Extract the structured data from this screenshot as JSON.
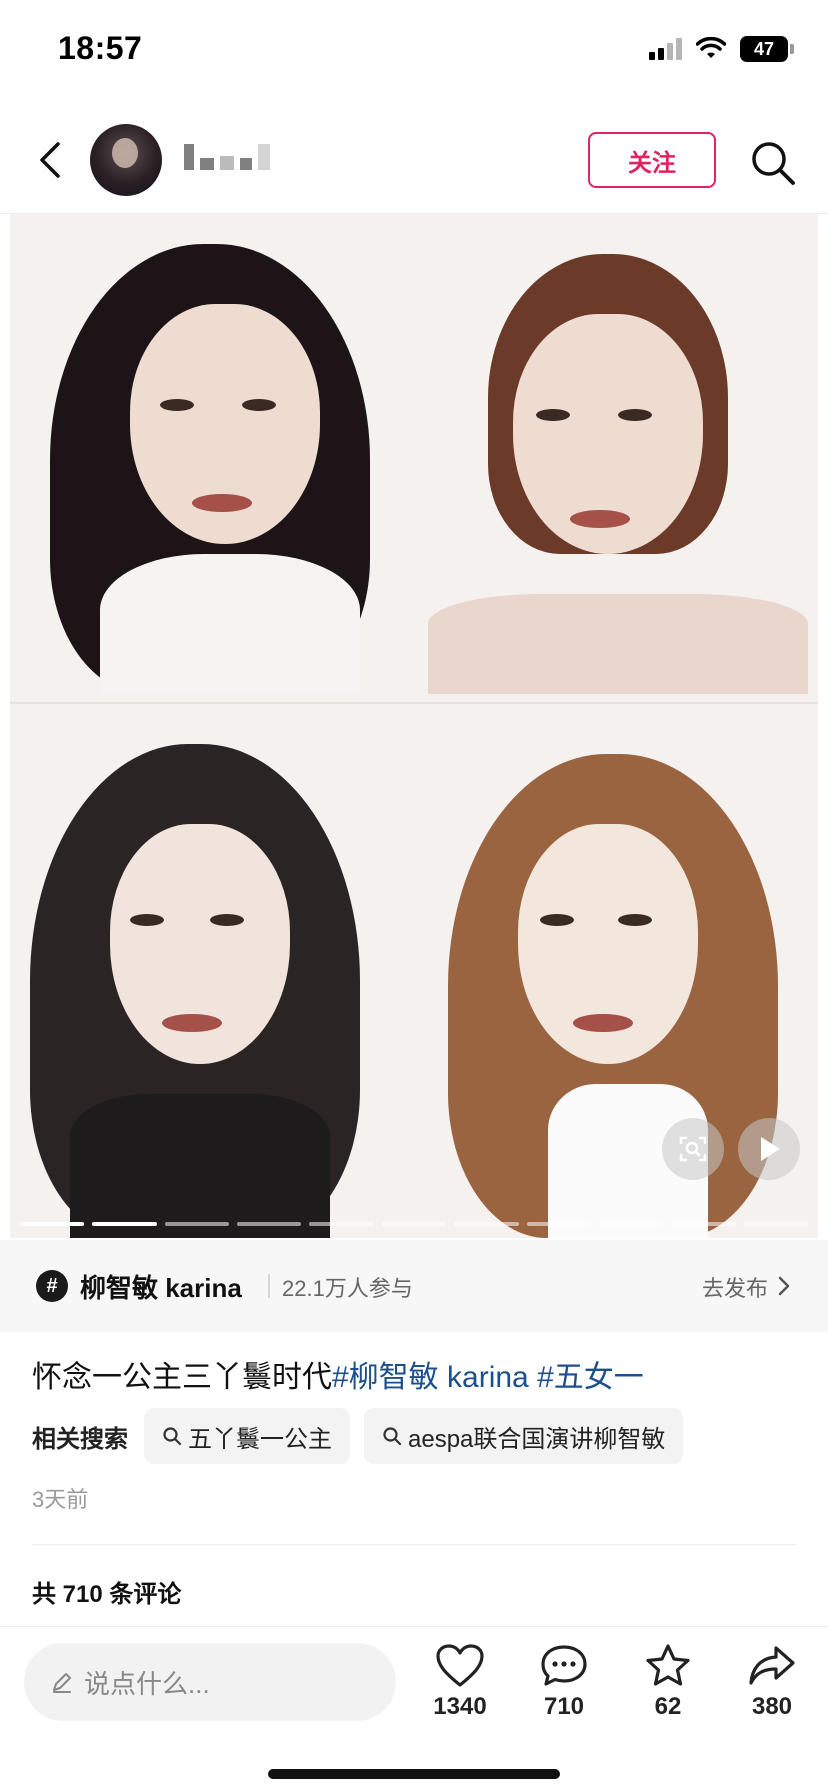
{
  "status": {
    "time": "18:57",
    "battery": "47"
  },
  "header": {
    "follow_label": "关注"
  },
  "post": {
    "progress": {
      "total": 11,
      "current": 1
    }
  },
  "topic": {
    "name": "柳智敏 karina",
    "participants": "22.1万人参与",
    "publish_label": "去发布"
  },
  "caption": {
    "text": "怀念一公主三丫鬟时代",
    "tags": [
      "#柳智敏 karina",
      "#五女一"
    ]
  },
  "related": {
    "label": "相关搜索",
    "items": [
      "五丫鬟一公主",
      "aespa联合国演讲柳智敏"
    ]
  },
  "time_ago": "3天前",
  "comments_total": "共 710 条评论",
  "bottom": {
    "input_placeholder": "说点什么...",
    "likes": "1340",
    "comments": "710",
    "stars": "62",
    "shares": "380"
  },
  "colors": {
    "accent": "#e0245e",
    "tag": "#1d4f8c"
  }
}
